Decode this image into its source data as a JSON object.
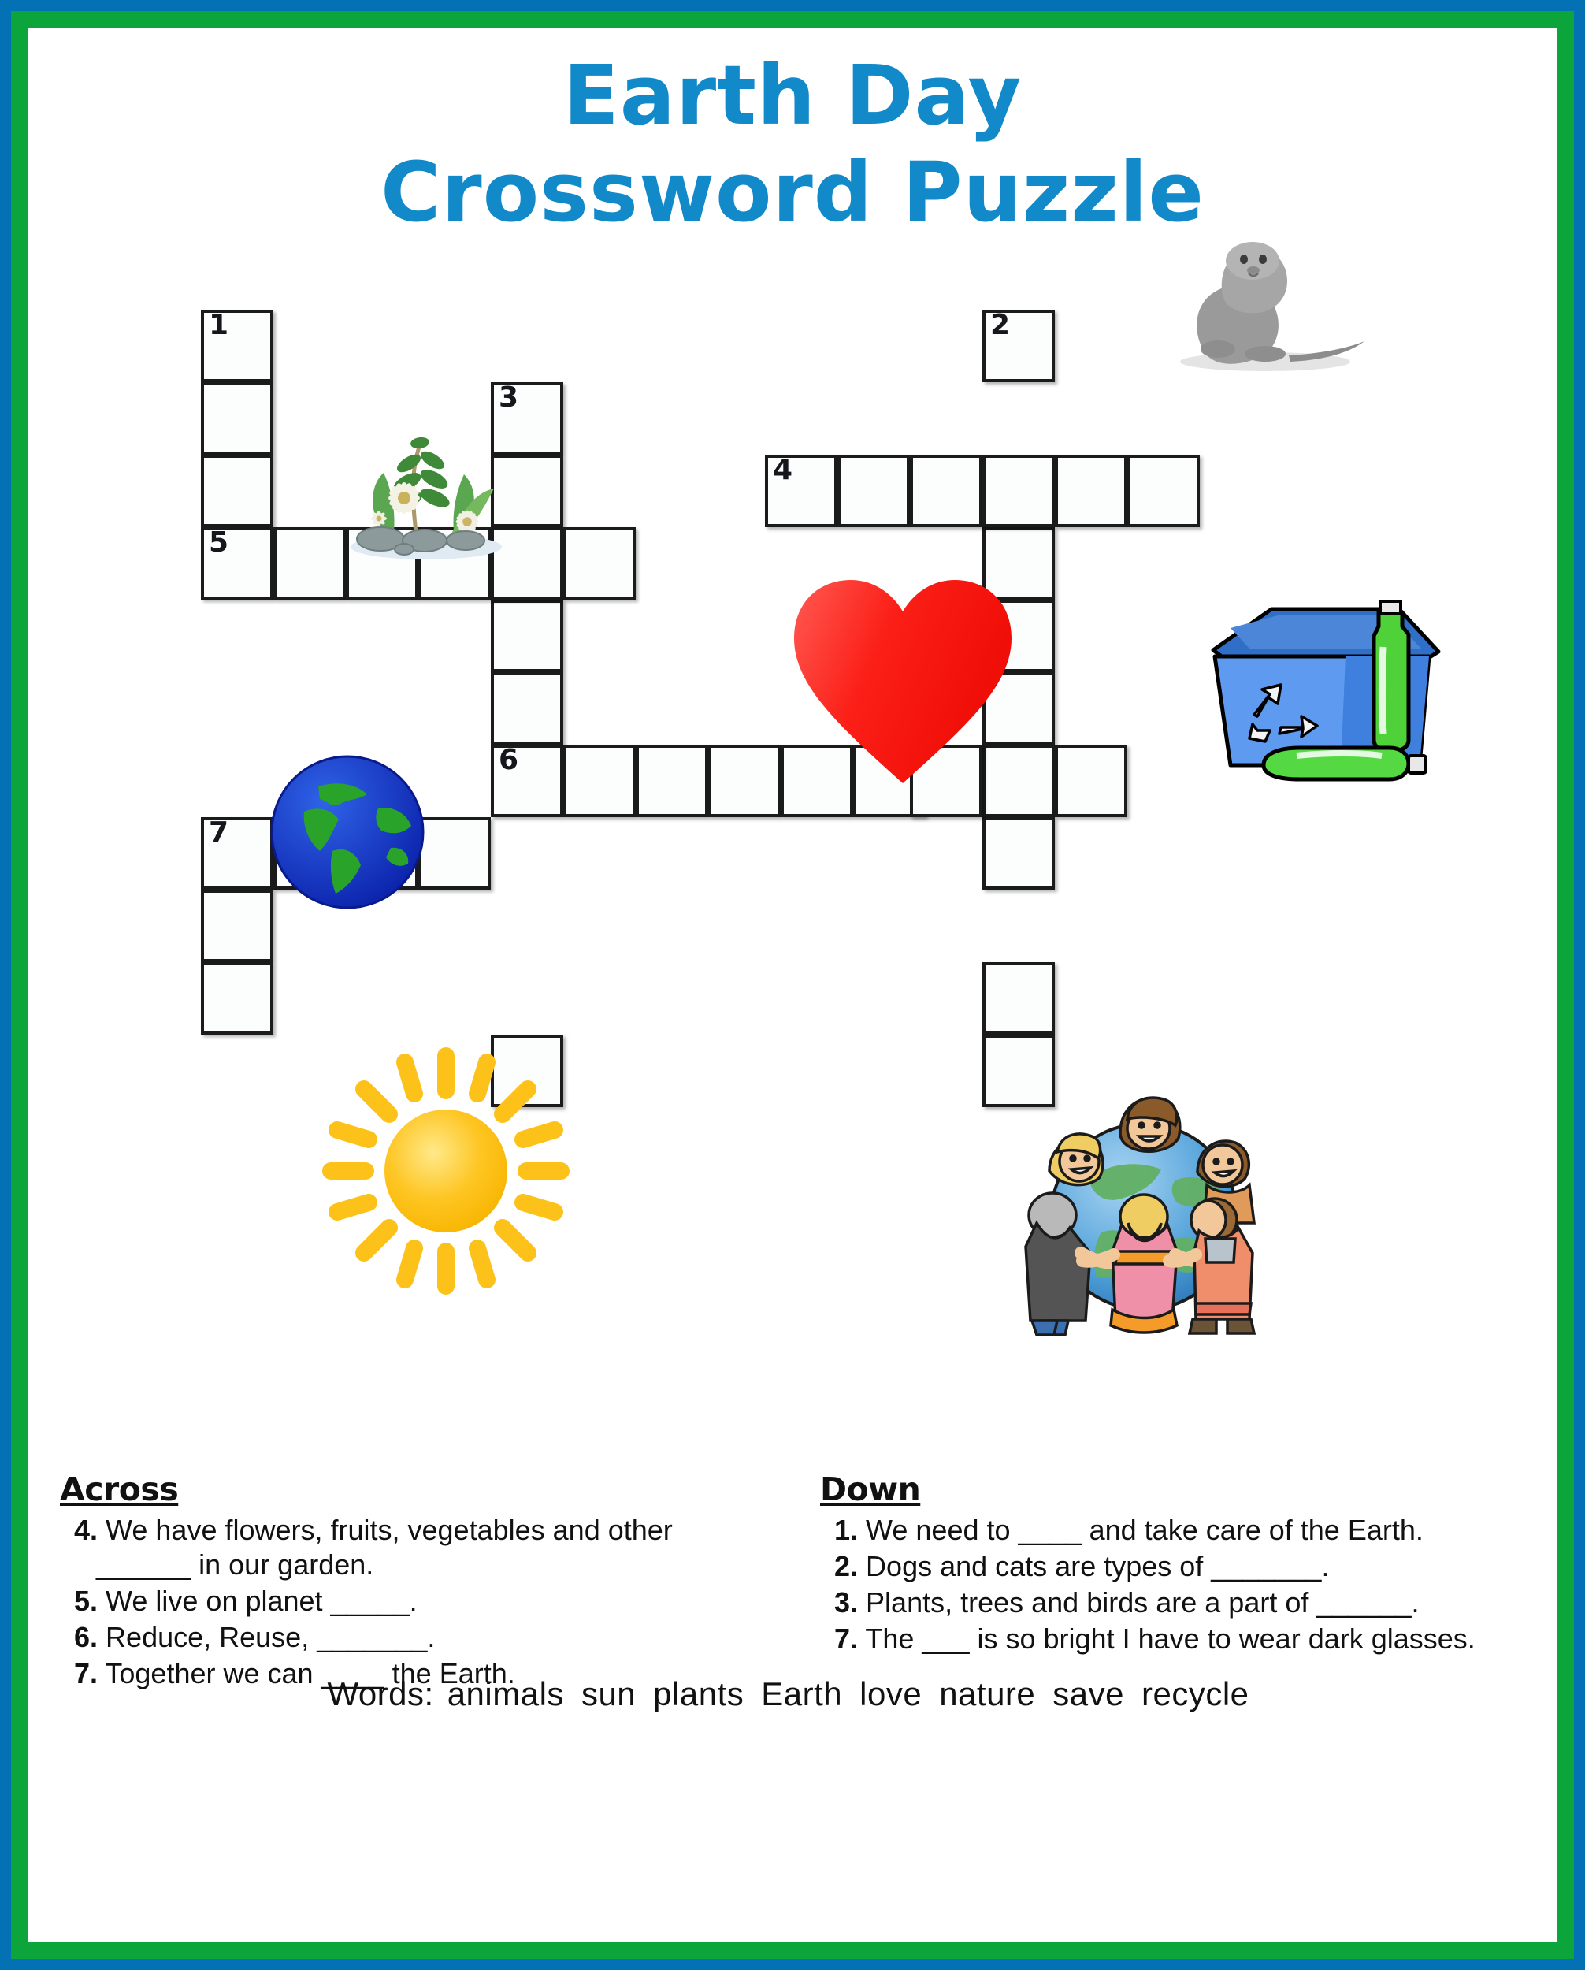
{
  "page": {
    "outer_border_color": "#0571b5",
    "inner_border_color": "#0ba53c",
    "background": "#ffffff"
  },
  "title": {
    "line1": "Earth Day",
    "line2": "Crossword Puzzle",
    "color": "#1289c8"
  },
  "puzzle": {
    "cell_size": 92,
    "numbers": [
      "1",
      "2",
      "3",
      "4",
      "5",
      "6",
      "7"
    ],
    "entries": [
      {
        "number": "1",
        "direction": "down",
        "length": 4,
        "col": 0,
        "row": 0
      },
      {
        "number": "2",
        "direction": "down",
        "length": 11,
        "col": 11,
        "row": 0
      },
      {
        "number": "3",
        "direction": "down",
        "length": 7,
        "col": 4,
        "row": 1
      },
      {
        "number": "4",
        "direction": "across",
        "length": 6,
        "col": 8,
        "row": 2
      },
      {
        "number": "5",
        "direction": "across",
        "length": 5,
        "col": 0,
        "row": 4
      },
      {
        "number": "6",
        "direction": "across",
        "length": 7,
        "col": 4,
        "row": 7
      },
      {
        "number": "7",
        "direction": "across",
        "length": 4,
        "col": 0,
        "row": 9
      },
      {
        "number": "7",
        "direction": "down",
        "length": 3,
        "col": 0,
        "row": 9
      }
    ]
  },
  "across": {
    "heading": "Across",
    "clues": [
      {
        "number": "4.",
        "text": "We have flowers, fruits, vegetables and other ______ in our garden."
      },
      {
        "number": "5.",
        "text": "We live on planet _____."
      },
      {
        "number": "6.",
        "text": "Reduce, Reuse, _______."
      },
      {
        "number": "7.",
        "text": "Together we can ____ the Earth."
      }
    ]
  },
  "down": {
    "heading": "Down",
    "clues": [
      {
        "number": "1.",
        "text": "We need to ____ and take care of the Earth."
      },
      {
        "number": "2.",
        "text": "Dogs and cats are types of _______."
      },
      {
        "number": "3.",
        "text": "Plants, trees and birds are a part of ______."
      },
      {
        "number": "7.",
        "text": "The ___ is so bright I have to wear dark glasses."
      }
    ]
  },
  "wordbank": {
    "label": "Words:",
    "words": [
      "animals",
      "sun",
      "plants",
      "Earth",
      "love",
      "nature",
      "save",
      "recycle"
    ]
  },
  "illustrations": [
    {
      "name": "plants-clipart",
      "label": "flowers and plants on rocks"
    },
    {
      "name": "earth-globe-clipart",
      "label": "planet Earth globe"
    },
    {
      "name": "heart-clipart",
      "label": "red heart"
    },
    {
      "name": "seal-clipart",
      "label": "grey seal animal"
    },
    {
      "name": "recycle-bin-clipart",
      "label": "blue recycling bin with green bottles"
    },
    {
      "name": "sun-clipart",
      "label": "yellow sun with rays"
    },
    {
      "name": "people-globe-clipart",
      "label": "people holding hands around the Earth"
    }
  ]
}
